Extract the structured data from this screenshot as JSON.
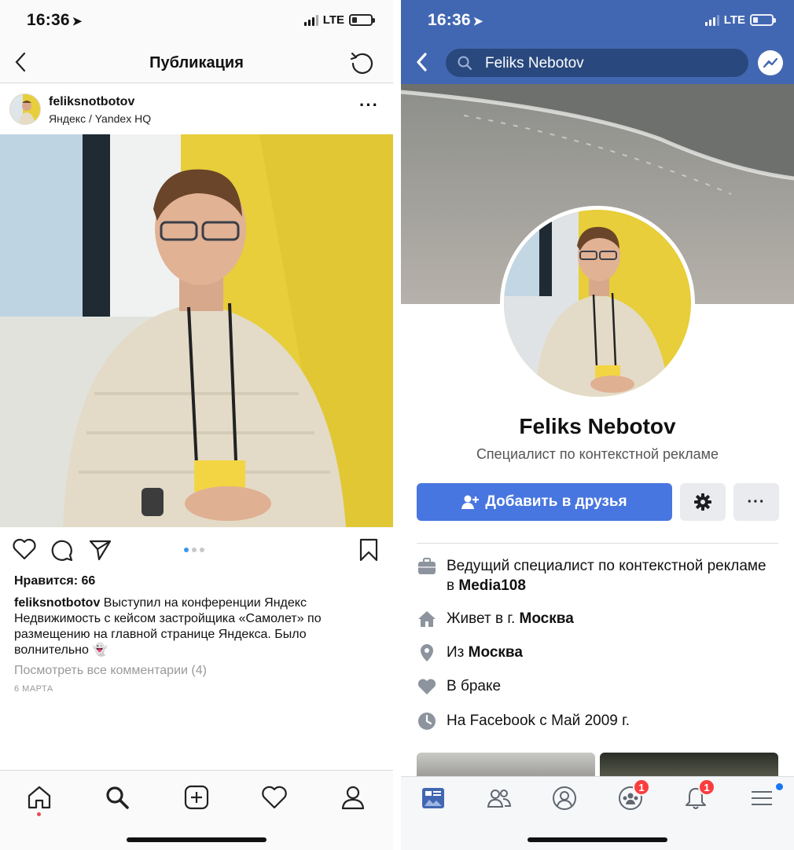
{
  "instagram": {
    "status": {
      "time": "16:36",
      "network": "LTE"
    },
    "nav": {
      "title": "Публикация"
    },
    "post": {
      "username": "feliksnotbotov",
      "location": "Яндекс / Yandex HQ",
      "likes": "Нравится: 66",
      "caption_user": "feliksnotbotov",
      "caption_text": "Выступил на конференции Яндекс Недвижимость с кейсом застройщика «Самолет» по размещению на главной странице Яндекса. Было волнительно 👻",
      "view_comments": "Посмотреть все комментарии (4)",
      "date": "6 МАРТА",
      "carousel": {
        "count": 3,
        "active": 1
      }
    },
    "tabbar": [
      "home-icon",
      "search-icon",
      "add-post-icon",
      "activity-heart-icon",
      "profile-icon"
    ]
  },
  "facebook": {
    "status": {
      "time": "16:36",
      "network": "LTE"
    },
    "search_query": "Feliks Nebotov",
    "profile": {
      "name": "Feliks Nebotov",
      "subtitle": "Специалист по контекстной рекламе",
      "add_friend": "Добавить в друзья"
    },
    "info": [
      {
        "icon": "briefcase-icon",
        "text": "Ведущий специалист по контекстной рекламе в ",
        "bold": "Media108"
      },
      {
        "icon": "house-icon",
        "text": "Живет в г. ",
        "bold": "Москва"
      },
      {
        "icon": "location-pin-icon",
        "text": "Из ",
        "bold": "Москва"
      },
      {
        "icon": "heart-icon",
        "text": "В браке",
        "bold": ""
      },
      {
        "icon": "clock-icon",
        "text": "На Facebook с Май 2009 г.",
        "bold": ""
      }
    ],
    "tabbar": {
      "groups_badge": "1",
      "notifications_badge": "1"
    },
    "colors": {
      "brand": "#4267b2",
      "button": "#4876e0",
      "badge": "#fa3e3e"
    }
  }
}
